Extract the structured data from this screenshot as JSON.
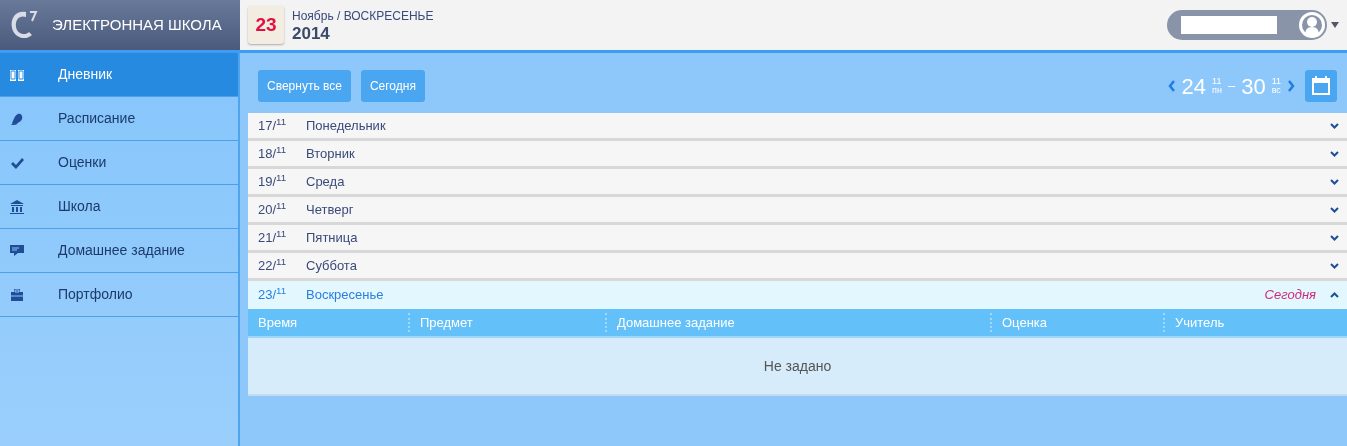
{
  "brand": {
    "title": "ЭЛЕКТРОННАЯ ШКОЛА"
  },
  "header": {
    "calendar_day": "23",
    "month_weekday": "Ноябрь / ВОСКРЕСЕНЬЕ",
    "year": "2014"
  },
  "sidebar": {
    "items": [
      {
        "label": "Дневник",
        "kind": "diary",
        "selected": true
      },
      {
        "label": "Расписание",
        "kind": "schedule",
        "selected": false
      },
      {
        "label": "Оценки",
        "kind": "grades",
        "selected": false
      },
      {
        "label": "Школа",
        "kind": "school",
        "selected": false
      },
      {
        "label": "Домашнее задание",
        "kind": "homework",
        "selected": false
      },
      {
        "label": "Портфолио",
        "kind": "portfolio",
        "selected": false
      }
    ]
  },
  "toolbar": {
    "buttons": [
      "Свернуть все",
      "Сегодня"
    ],
    "week": {
      "start_day": "24",
      "start_month": "11",
      "start_weekday": "пн",
      "dash": "–",
      "end_day": "30",
      "end_month": "11",
      "end_weekday": "вс"
    }
  },
  "days": [
    {
      "date": "17/$^{11}$",
      "name": "Понедельник",
      "today": false,
      "expanded": false
    },
    {
      "date": "18/$^{11}$",
      "name": "Вторник",
      "today": false,
      "expanded": false
    },
    {
      "date": "19/$^{11}$",
      "name": "Среда",
      "today": false,
      "expanded": false
    },
    {
      "date": "20/$^{11}$",
      "name": "Четверг",
      "today": false,
      "expanded": false
    },
    {
      "date": "21/$^{11}$",
      "name": "Пятница",
      "today": false,
      "expanded": false
    },
    {
      "date": "22/$^{11}$",
      "name": "Суббота",
      "today": false,
      "expanded": false
    },
    {
      "date": "23/$^{11}$",
      "name": "Воскресенье",
      "today": true,
      "expanded": true
    }
  ],
  "today_label": "Сегодня",
  "table": {
    "columns": [
      "Время",
      "Предмет",
      "Домашнее задание",
      "Оценка",
      "Учитель"
    ],
    "empty": "Не задано"
  }
}
